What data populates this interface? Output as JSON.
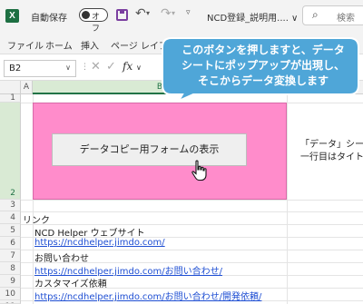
{
  "titlebar": {
    "app_logo": "X",
    "autosave_label": "自動保存",
    "autosave_state": "オフ",
    "doc_title": "NCD登録_説明用.... ∨",
    "search_placeholder": "検索",
    "icons": [
      "save-icon",
      "undo-icon",
      "redo-icon",
      "more-icon",
      "search-icon"
    ]
  },
  "ribbon": {
    "tabs": [
      "ファイル",
      "ホーム",
      "挿入",
      "ページ レイアウト"
    ]
  },
  "formula_bar": {
    "name_box": "B2",
    "fx": "fx"
  },
  "columns": [
    "A",
    "B"
  ],
  "rows": [
    "1",
    "2",
    "3",
    "4",
    "5",
    "6",
    "7",
    "8",
    "9",
    "10",
    "11"
  ],
  "callout": {
    "lines": [
      "このボタンを押しますと、データ",
      "シートにポップアップが出現し、",
      "そこからデータ変換します"
    ],
    "color": "#4fa6d8"
  },
  "shape": {
    "color": "#ff8ccb",
    "button_label": "データコピー用フォームの表示"
  },
  "side_notes": [
    "「データ」シート",
    "一行目はタイト"
  ],
  "cells": {
    "r4": "リンク",
    "r5": "NCD Helper ウェブサイト",
    "r6": "https://ncdhelper.jimdo.com/",
    "r7": "お問い合わせ",
    "r8": "https://ncdhelper.jimdo.com/お問い合わせ/",
    "r9": "カスタマイズ依頼",
    "r10": "https://ncdhelper.jimdo.com/お問い合わせ/開発依頼/"
  }
}
